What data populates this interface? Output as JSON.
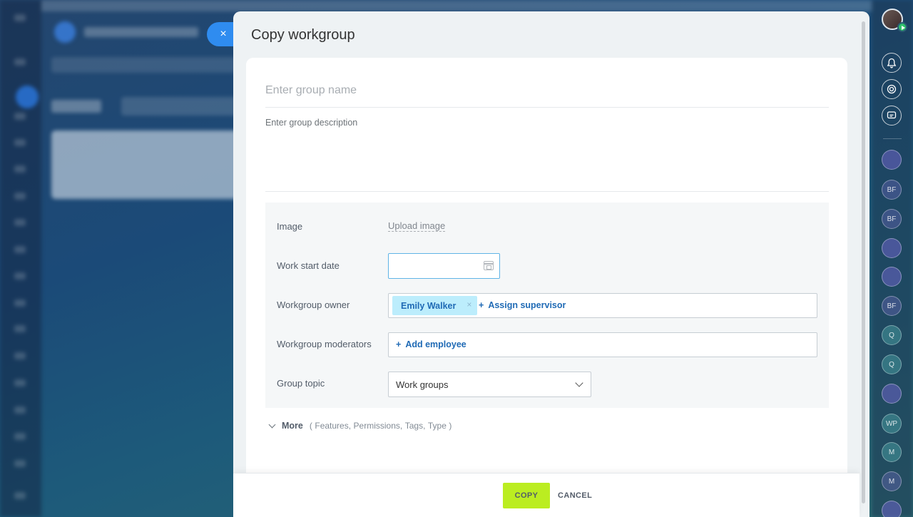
{
  "modal": {
    "title": "Copy workgroup",
    "close_icon": "×",
    "name_placeholder": "Enter group name",
    "description_placeholder": "Enter group description"
  },
  "fields": {
    "image_label": "Image",
    "upload_image": "Upload image",
    "start_date_label": "Work start date",
    "start_date_value": "",
    "owner_label": "Workgroup owner",
    "owner_tag": "Emily Walker",
    "assign_supervisor": "Assign supervisor",
    "moderators_label": "Workgroup moderators",
    "add_employee": "Add employee",
    "topic_label": "Group topic",
    "topic_value": "Work groups",
    "add_plus": "+",
    "remove_x": "×"
  },
  "more": {
    "label": "More",
    "open_paren": "(",
    "close_paren": ")",
    "items": [
      "Features,",
      "Permissions,",
      "Tags,",
      "Type"
    ]
  },
  "footer": {
    "copy_label": "COPY",
    "cancel_label": "CANCEL"
  },
  "right_sidebar": {
    "icons": [
      "bell-icon",
      "copilot-icon",
      "chat-search-icon"
    ],
    "chats": [
      "",
      "BF",
      "BF",
      "",
      "",
      "BF",
      "Q",
      "Q",
      "",
      "WP",
      "M",
      "M",
      ""
    ]
  },
  "colors": {
    "accent_blue": "#2f8cf0",
    "copy_button": "#bbed21",
    "tag_bg": "#bcedfc",
    "link_blue": "#1f6ab5"
  }
}
